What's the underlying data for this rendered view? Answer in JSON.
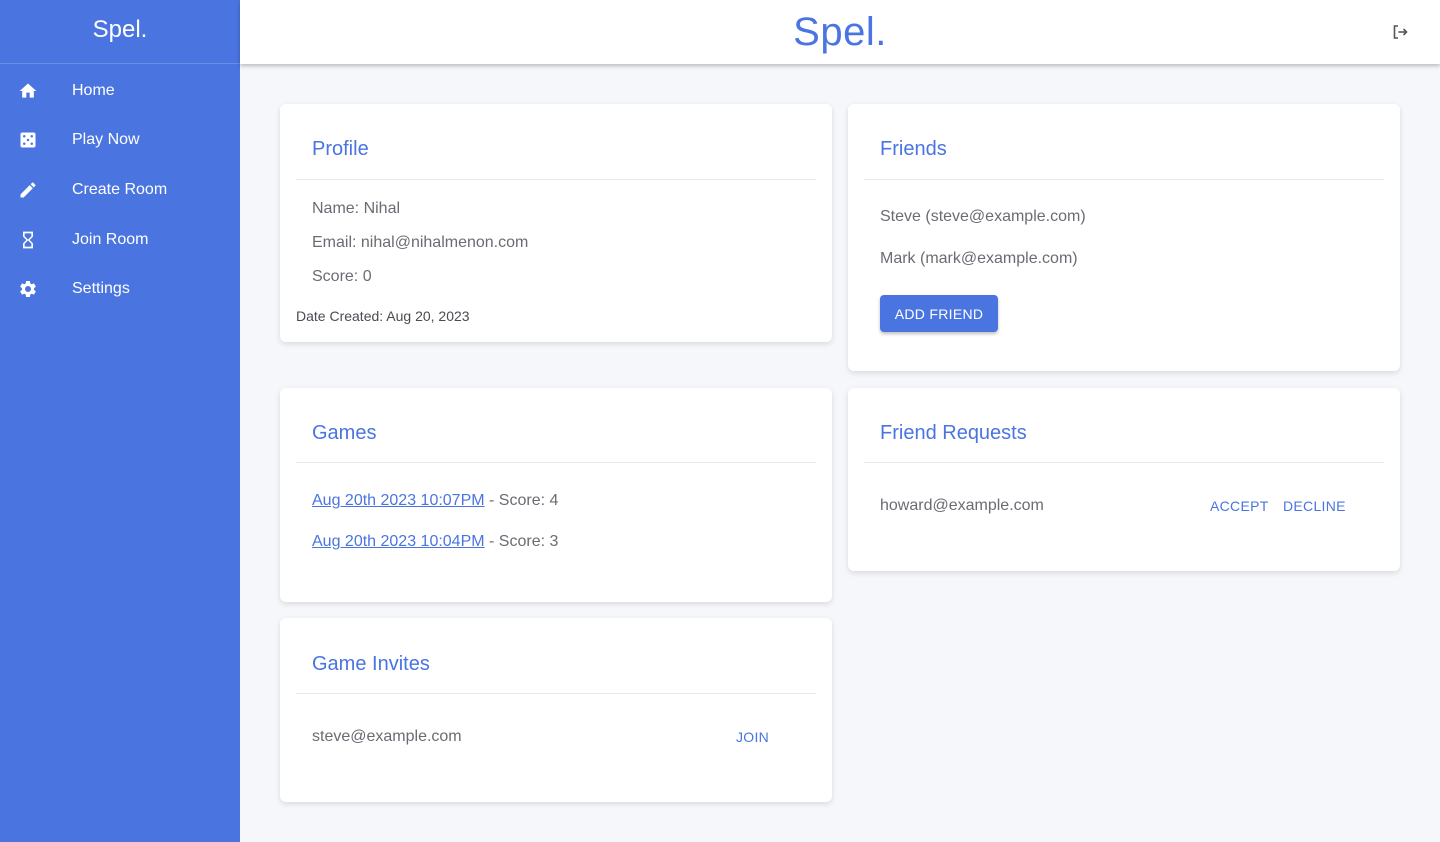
{
  "app": {
    "brand": "Spel.",
    "header_title": "Spel."
  },
  "sidebar": {
    "items": [
      {
        "label": "Home",
        "icon": "home-icon"
      },
      {
        "label": "Play Now",
        "icon": "dice-icon"
      },
      {
        "label": "Create Room",
        "icon": "pencil-icon"
      },
      {
        "label": "Join Room",
        "icon": "hourglass-icon"
      },
      {
        "label": "Settings",
        "icon": "gear-icon"
      }
    ]
  },
  "profile": {
    "title": "Profile",
    "name": "Name: Nihal",
    "email": "Email: nihal@nihalmenon.com",
    "score": "Score: 0",
    "date_created": "Date Created: Aug 20, 2023"
  },
  "friends": {
    "title": "Friends",
    "list": [
      "Steve (steve@example.com)",
      "Mark (mark@example.com)"
    ],
    "add_button": "ADD FRIEND"
  },
  "games": {
    "title": "Games",
    "list": [
      {
        "date": "Aug 20th 2023 10:07PM",
        "score": " - Score: 4"
      },
      {
        "date": "Aug 20th 2023 10:04PM",
        "score": " - Score: 3"
      }
    ]
  },
  "friend_requests": {
    "title": "Friend Requests",
    "list": [
      {
        "email": "howard@example.com",
        "accept": "ACCEPT",
        "decline": "DECLINE"
      }
    ]
  },
  "game_invites": {
    "title": "Game Invites",
    "list": [
      {
        "email": "steve@example.com",
        "join": "JOIN"
      }
    ]
  },
  "colors": {
    "accent": "#4a74e0",
    "background": "#f5f7fb",
    "text": "#6b6b73"
  }
}
